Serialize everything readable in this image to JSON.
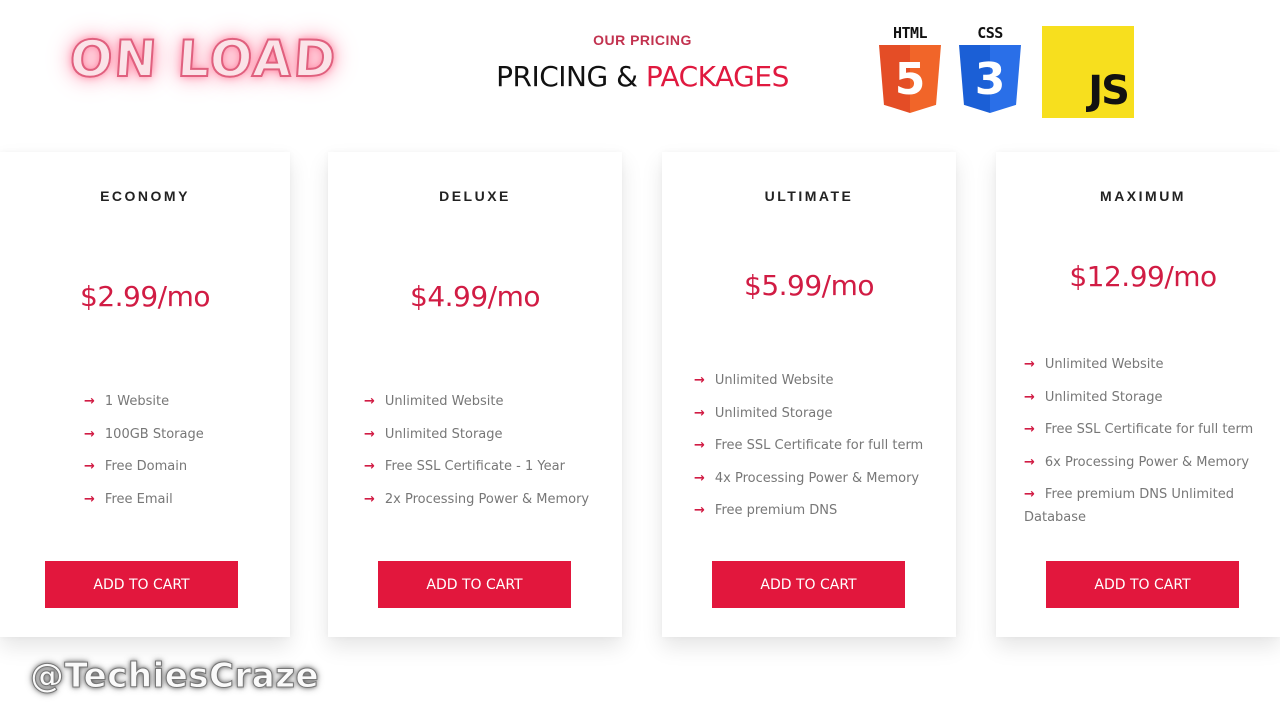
{
  "overlay": {
    "label": "ON LOAD",
    "watermark": "@TechiesCraze"
  },
  "header": {
    "subtitle": "OUR PRICING",
    "title_main": "PRICING &",
    "title_accent": "PACKAGES"
  },
  "logos": {
    "html": {
      "label": "HTML",
      "glyph": "5",
      "color": "#e44d26"
    },
    "css": {
      "label": "CSS",
      "glyph": "3",
      "color": "#1b5fd6"
    },
    "js": {
      "label": "JS",
      "color": "#f7df1e"
    }
  },
  "colors": {
    "accent": "#e2173d",
    "price": "#d11c44",
    "feature_text": "#777777"
  },
  "plans": [
    {
      "name": "ECONOMY",
      "price": "$2.99/mo",
      "features": [
        "1 Website",
        "100GB Storage",
        "Free Domain",
        "Free Email"
      ],
      "button": "ADD TO CART"
    },
    {
      "name": "DELUXE",
      "price": "$4.99/mo",
      "features": [
        "Unlimited Website",
        "Unlimited Storage",
        "Free SSL Certificate - 1 Year",
        "2x Processing Power & Memory"
      ],
      "button": "ADD TO CART"
    },
    {
      "name": "ULTIMATE",
      "price": "$5.99/mo",
      "features": [
        "Unlimited Website",
        "Unlimited Storage",
        "Free SSL Certificate for full term",
        "4x Processing Power & Memory",
        "Free premium DNS"
      ],
      "button": "ADD TO CART"
    },
    {
      "name": "MAXIMUM",
      "price": "$12.99/mo",
      "features": [
        "Unlimited Website",
        "Unlimited Storage",
        "Free SSL Certificate for full term",
        "6x Processing Power & Memory",
        "Free premium DNS Unlimited Database"
      ],
      "button": "ADD TO CART"
    }
  ],
  "icons": {
    "feature_arrow": "→"
  }
}
